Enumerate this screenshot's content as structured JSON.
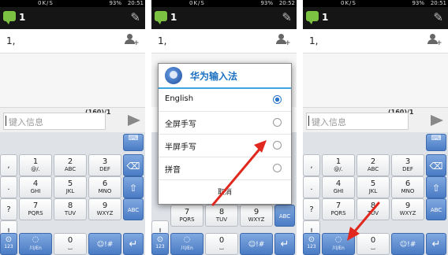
{
  "status": {
    "net": "0K/S",
    "battery": "93%",
    "time_left": "20:51",
    "time_mid": "20:52",
    "time_right": "20:51"
  },
  "thread": {
    "title": "1"
  },
  "recipient": {
    "value": "1,"
  },
  "compose": {
    "placeholder": "键入信息",
    "counter": "(160)/1"
  },
  "keyboard": {
    "symbols": [
      ",",
      ".",
      "?",
      "!"
    ],
    "keys": [
      {
        "num": "1",
        "sub": "@/."
      },
      {
        "num": "2",
        "sub": "ABC"
      },
      {
        "num": "3",
        "sub": "DEF"
      },
      {
        "num": "4",
        "sub": "GHI"
      },
      {
        "num": "5",
        "sub": "JKL"
      },
      {
        "num": "6",
        "sub": "MNO"
      },
      {
        "num": "7",
        "sub": "PQRS"
      },
      {
        "num": "8",
        "sub": "TUV"
      },
      {
        "num": "9",
        "sub": "WXYZ"
      }
    ],
    "zero": "0",
    "bottom_left_sub": "123",
    "lang_key": "川/En",
    "sym_key": "☺!#",
    "abc_key": "ABC"
  },
  "dialog": {
    "title": "华为输入法",
    "options": [
      {
        "label": "English",
        "selected": true
      },
      {
        "label": "全屏手写",
        "selected": false
      },
      {
        "label": "半屏手写",
        "selected": false
      },
      {
        "label": "拼音",
        "selected": false
      }
    ],
    "cancel": "取消"
  },
  "colors": {
    "accent": "#3aa7e0",
    "annotation_arrow": "#e0281e",
    "key_blue": "#4a7bc4"
  }
}
